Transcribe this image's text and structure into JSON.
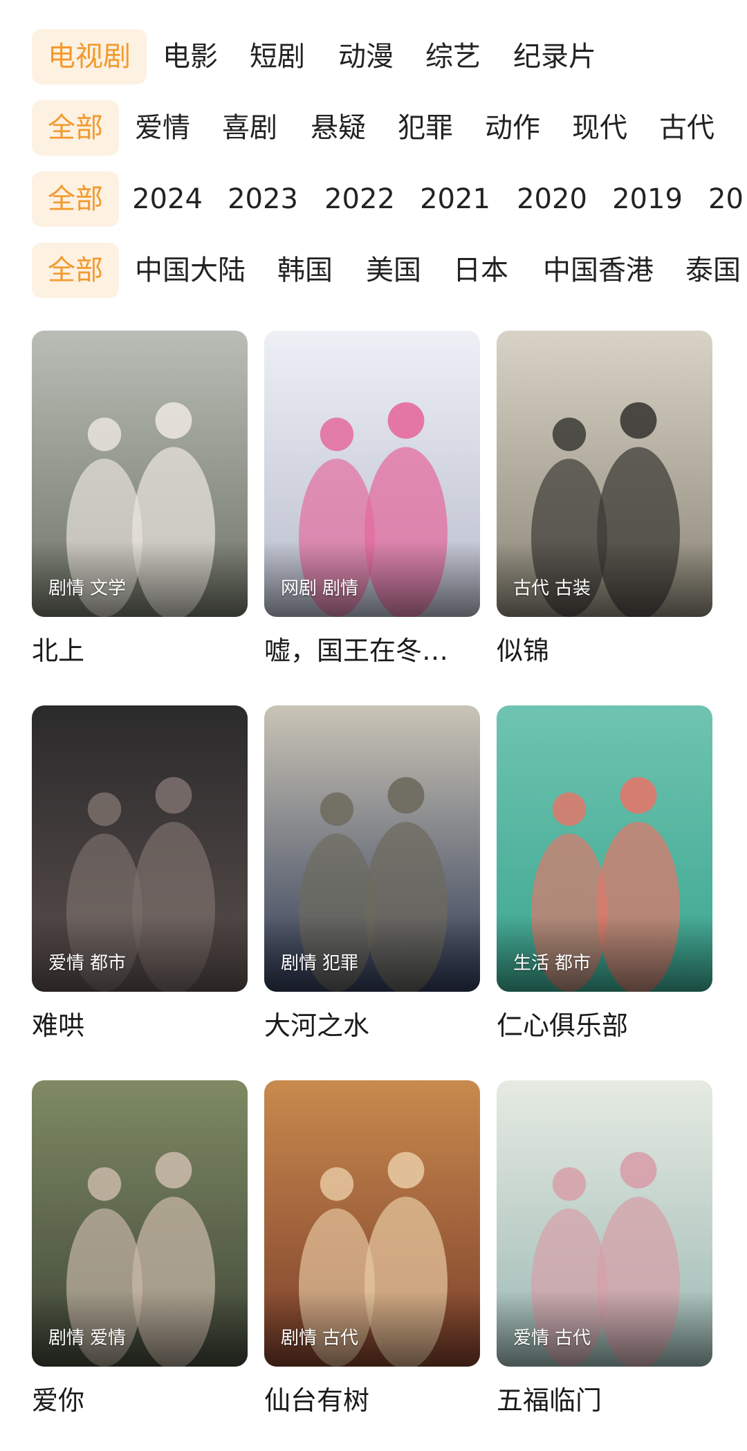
{
  "filters": {
    "type": [
      "电视剧",
      "电影",
      "短剧",
      "动漫",
      "综艺",
      "纪录片"
    ],
    "genre": [
      "全部",
      "爱情",
      "喜剧",
      "悬疑",
      "犯罪",
      "动作",
      "现代",
      "古代"
    ],
    "year": [
      "全部",
      "2024",
      "2023",
      "2022",
      "2021",
      "2020",
      "2019",
      "20"
    ],
    "region": [
      "全部",
      "中国大陆",
      "韩国",
      "美国",
      "日本",
      "中国香港",
      "泰国"
    ]
  },
  "accent_color": "#f29a2e",
  "accent_bg": "#fdf1e2",
  "shows": [
    {
      "title": "北上",
      "tags": [
        "剧情",
        "文学"
      ],
      "colors": [
        "#b9bdb6",
        "#6f7466",
        "#e9e4dc"
      ]
    },
    {
      "title": "嘘，国王在冬…",
      "tags": [
        "网剧",
        "剧情"
      ],
      "colors": [
        "#eef0f6",
        "#b8bccb",
        "#e46a9c"
      ]
    },
    {
      "title": "似锦",
      "tags": [
        "古代",
        "古装"
      ],
      "colors": [
        "#d8d3c6",
        "#8a8576",
        "#3b3a35"
      ]
    },
    {
      "title": "难哄",
      "tags": [
        "爱情",
        "都市"
      ],
      "colors": [
        "#2b2a2c",
        "#5a4f4c",
        "#7a6e6a"
      ]
    },
    {
      "title": "大河之水",
      "tags": [
        "剧情",
        "犯罪"
      ],
      "colors": [
        "#c9c4b6",
        "#2f3a55",
        "#6d6a5d"
      ]
    },
    {
      "title": "仁心俱乐部",
      "tags": [
        "生活",
        "都市"
      ],
      "colors": [
        "#6fc4b0",
        "#3aa58f",
        "#e2776a"
      ]
    },
    {
      "title": "爱你",
      "tags": [
        "剧情",
        "爱情"
      ],
      "colors": [
        "#7f8a64",
        "#3f4638",
        "#c9b8a8"
      ]
    },
    {
      "title": "仙台有树",
      "tags": [
        "剧情",
        "古代"
      ],
      "colors": [
        "#c98a4e",
        "#7a3e2a",
        "#e6c7a0"
      ]
    },
    {
      "title": "五福临门",
      "tags": [
        "爱情",
        "古代"
      ],
      "colors": [
        "#e6ebe2",
        "#9bb8b3",
        "#d79fa8"
      ]
    }
  ]
}
